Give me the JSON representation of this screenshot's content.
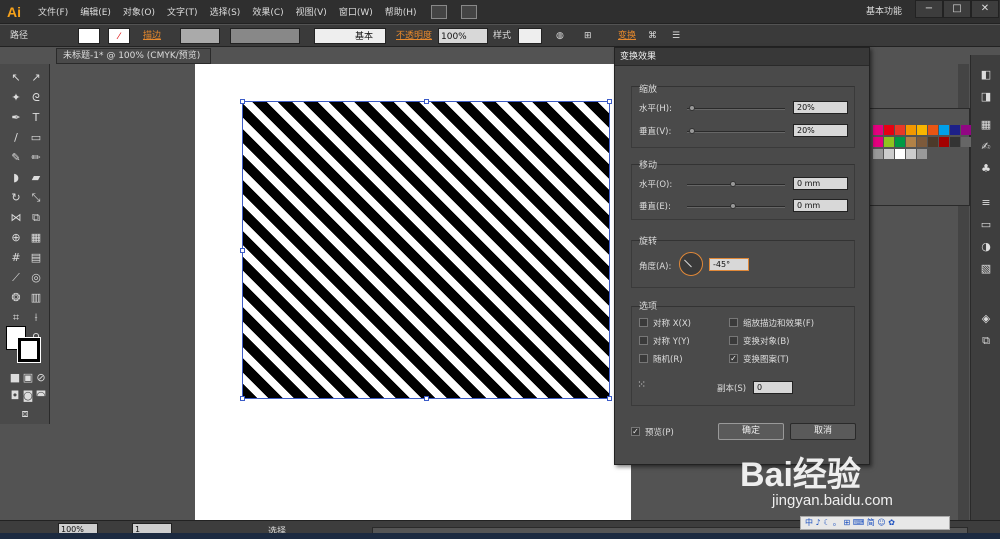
{
  "app": {
    "logo": "Ai",
    "workspace": "基本功能"
  },
  "menu": [
    "文件(F)",
    "编辑(E)",
    "对象(O)",
    "文字(T)",
    "选择(S)",
    "效果(C)",
    "视图(V)",
    "窗口(W)",
    "帮助(H)"
  ],
  "control_bar": {
    "path_label": "路径",
    "stroke_label": "描边",
    "brush_label": "基本",
    "opacity_label": "不透明度",
    "opacity_value": "100%",
    "style_label": "样式",
    "transform_label": "变换"
  },
  "doc_tab": "未标题-1* @ 100% (CMYK/预览)",
  "status": {
    "zoom": "100%",
    "page": "1",
    "tool": "选择"
  },
  "dialog": {
    "title": "变换效果",
    "scale": {
      "title": "缩放",
      "h_label": "水平(H):",
      "h_value": "20%",
      "v_label": "垂直(V):",
      "v_value": "20%"
    },
    "move": {
      "title": "移动",
      "h_label": "水平(O):",
      "h_value": "0 mm",
      "v_label": "垂直(E):",
      "v_value": "0 mm"
    },
    "rotate": {
      "title": "旋转",
      "angle_label": "角度(A):",
      "angle_value": "-45°"
    },
    "options": {
      "title": "选项",
      "reflect_x": "对称 X(X)",
      "reflect_y": "对称 Y(Y)",
      "random": "随机(R)",
      "scale_strokes": "缩放描边和效果(F)",
      "transform_objects": "变换对象(B)",
      "transform_patterns": "变换图案(T)",
      "copies_label": "副本(S)",
      "copies_value": "0"
    },
    "preview_label": "预览(P)",
    "ok_label": "确定",
    "cancel_label": "取消"
  },
  "watermark": {
    "logo": "Bai经验",
    "url": "jingyan.baidu.com"
  },
  "ime": "中 ♪ ☾ 。 ⊞ ⌨ 简 ☺ ✿",
  "swatch_colors": [
    "#e4007f",
    "#e60012",
    "#e83828",
    "#f39800",
    "#f8b500",
    "#e95513",
    "#00a0e9",
    "#1d2088",
    "#920783",
    "#e4007f",
    "#8fc31f",
    "#009944",
    "#b28247",
    "#7d5a3b",
    "#4c3a2a",
    "#a40000",
    "#333333",
    "#666666",
    "#999999",
    "#cccccc",
    "#ffffff",
    "#cccccc",
    "#999999"
  ]
}
